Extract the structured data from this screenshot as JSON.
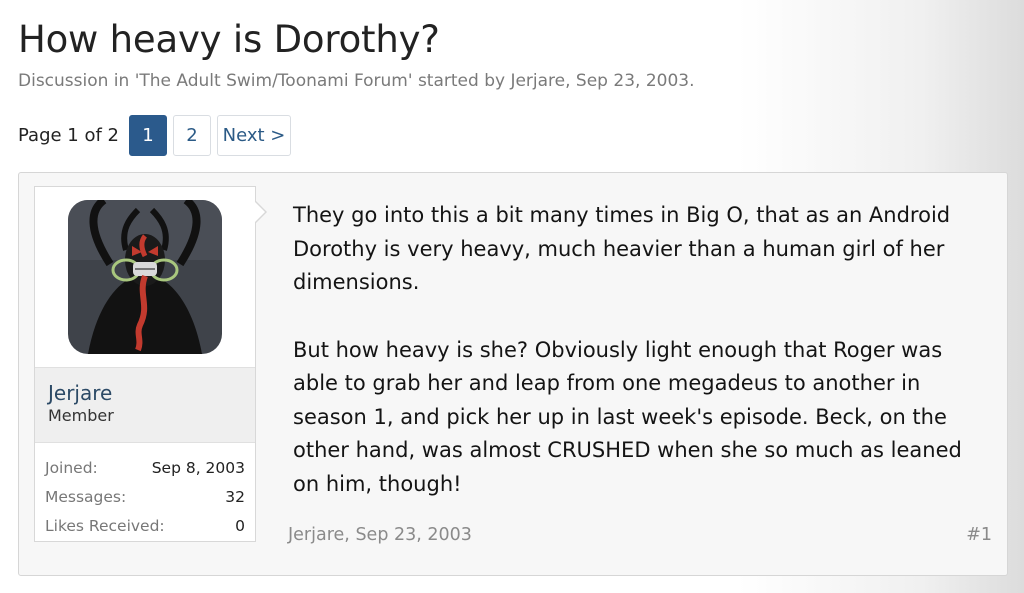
{
  "thread": {
    "title": "How heavy is Dorothy?",
    "description": "Discussion in 'The Adult Swim/Toonami Forum' started by Jerjare, Sep 23, 2003."
  },
  "pagination": {
    "label": "Page 1 of 2",
    "pages": [
      "1",
      "2"
    ],
    "current_page": "1",
    "next_label": "Next >"
  },
  "post": {
    "author": {
      "name": "Jerjare",
      "title": "Member",
      "avatar_icon": "avatar-icon",
      "stats": [
        {
          "label": "Joined:",
          "value": "Sep 8, 2003"
        },
        {
          "label": "Messages:",
          "value": "32"
        },
        {
          "label": "Likes Received:",
          "value": "0"
        }
      ]
    },
    "paragraphs": [
      "They go into this a bit many times in Big O, that as an Android Dorothy is very heavy, much heavier than a human girl of her dimensions.",
      "But how heavy is she? Obviously light enough that Roger was able to grab her and leap from one megadeus to another in season 1, and pick her up in last week's episode. Beck, on the other hand, was almost CRUSHED when she so much as leaned on him, though!"
    ],
    "meta": {
      "author": "Jerjare",
      "separator": ", ",
      "date": "Sep 23, 2003",
      "number": "#1"
    }
  },
  "colors": {
    "accent": "#2b5a8c",
    "link": "#2c4a66",
    "muted": "#7a7a7a"
  }
}
